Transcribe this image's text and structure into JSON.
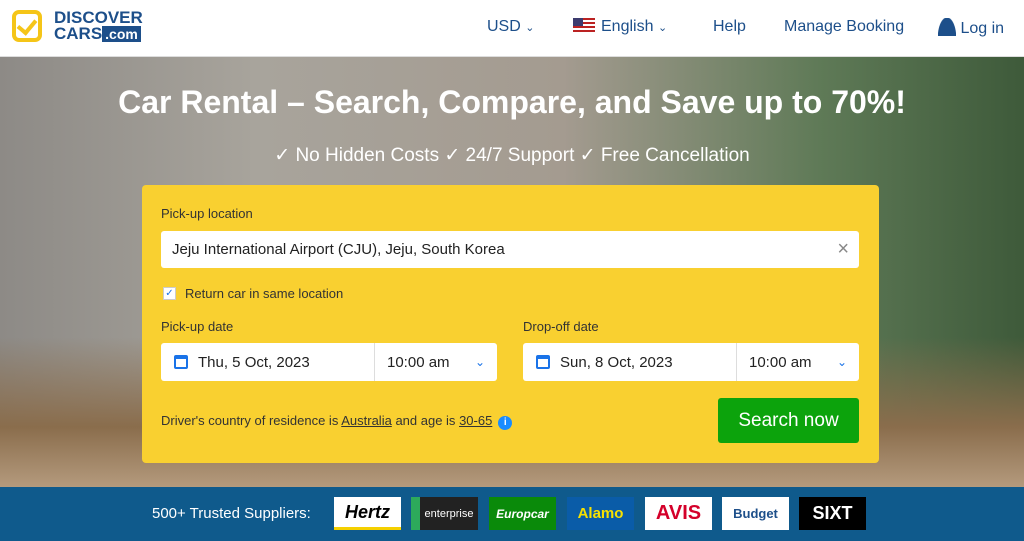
{
  "header": {
    "logo_line1": "DISCOVER",
    "logo_line2": "CARS",
    "logo_com": ".com",
    "currency": "USD",
    "language": "English",
    "help": "Help",
    "manage": "Manage Booking",
    "login": "Log in"
  },
  "hero": {
    "title": "Car Rental – Search, Compare, and Save up to 70%!",
    "subtitle": "✓ No Hidden Costs ✓ 24/7 Support ✓ Free Cancellation"
  },
  "form": {
    "pickup_label": "Pick-up location",
    "pickup_value": "Jeju International Airport (CJU), Jeju, South Korea",
    "return_same": "Return car in same location",
    "return_checked": true,
    "pickup_date_label": "Pick-up date",
    "pickup_date": "Thu, 5 Oct, 2023",
    "pickup_time": "10:00 am",
    "dropoff_date_label": "Drop-off date",
    "dropoff_date": "Sun, 8 Oct, 2023",
    "dropoff_time": "10:00 am",
    "driver_prefix": "Driver's country of residence is",
    "country": "Australia",
    "age_prefix": "and age is",
    "age": "30-65",
    "search": "Search now"
  },
  "suppliers": {
    "label": "500+ Trusted Suppliers:",
    "items": [
      "Hertz",
      "enterprise",
      "Europcar",
      "Alamo",
      "AVIS",
      "Budget",
      "SIXT"
    ]
  },
  "colors": {
    "panel": "#f9d030",
    "search": "#0ca30c",
    "bar": "#0f5a8c",
    "brand": "#1d4f8a"
  }
}
